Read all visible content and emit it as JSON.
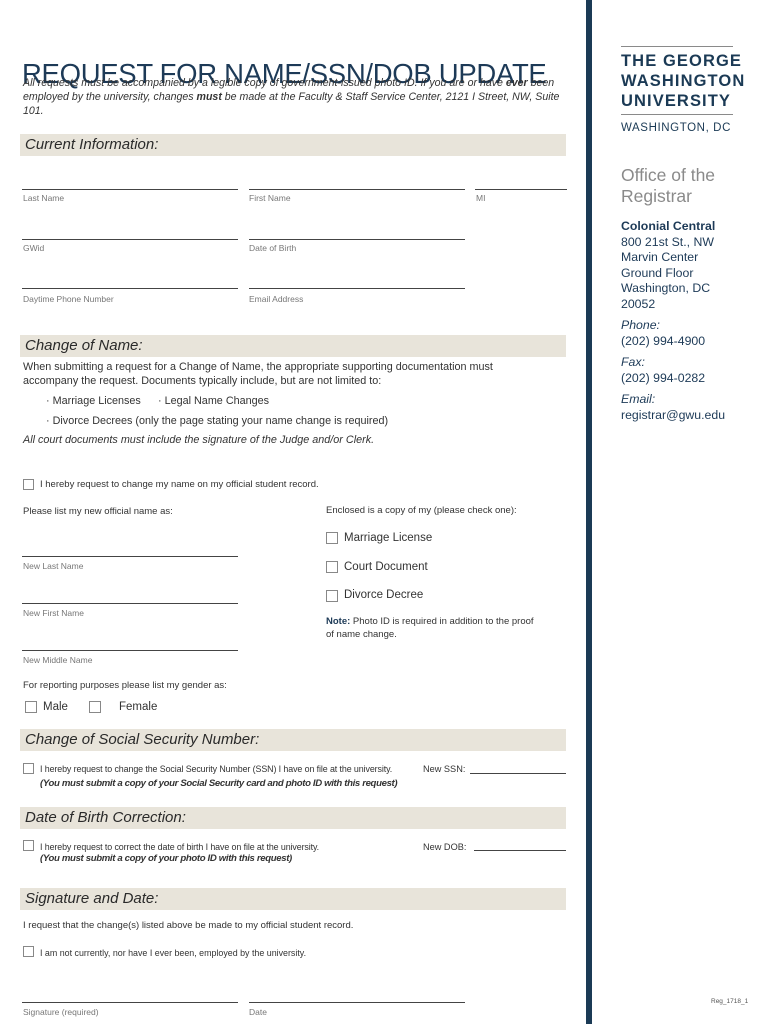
{
  "document": {
    "title": "REQUEST FOR NAME/SSN/DOB UPDATE",
    "intro": {
      "part1": "All requests must be accompanied by a legible copy of government-issued photo ID. If you are or have ",
      "bold1": "ever",
      "part2": " been employed by the university, changes ",
      "bold2": "must",
      "part3": " be made at the Faculty & Staff Service Center, 2121 I Street, NW, Suite 101."
    },
    "form_code": "Reg_1718_1"
  },
  "sections": {
    "current": {
      "heading": "Current Information:",
      "fields": {
        "last_name": "Last Name",
        "first_name": "First Name",
        "mi": "MI",
        "gwid": "GWid",
        "dob": "Date of Birth",
        "phone": "Daytime Phone Number",
        "email": "Email Address"
      }
    },
    "name": {
      "heading": "Change of Name:",
      "desc_line1": "When submitting a request for a Change of Name, the appropriate supporting documentation must",
      "desc_line2": "accompany the request. Documents typically include, but are not limited to:",
      "docs": [
        "· Marriage Licenses",
        "· Legal Name Changes",
        "· Divorce Decrees (only the page stating your name change is required)"
      ],
      "court_note": "All court documents must include the signature of the Judge and/or Clerk.",
      "request_checkbox": "I hereby request to change my name on my official student record.",
      "list_prompt": "Please list my new official name as:",
      "enclosed_prompt": "Enclosed is a copy of my (please check one):",
      "enclosed_options": [
        "Marriage License",
        "Court Document",
        "Divorce Decree"
      ],
      "new_fields": {
        "last": "New Last Name",
        "first": "New First Name",
        "middle": "New Middle Name"
      },
      "note_label": "Note:",
      "note_line1": " Photo ID is required in addition to the proof",
      "note_line2": "of name change.",
      "gender_prompt": "For reporting purposes please list my gender as:",
      "gender_options": [
        "Male",
        "Female"
      ]
    },
    "ssn": {
      "heading": "Change of Social Security Number:",
      "checkbox": "I hereby request to change the Social Security Number (SSN) I have on file at the university.",
      "field_label": "New SSN:",
      "condition": "(You must submit a copy of your Social Security card and photo ID with this request)"
    },
    "dob": {
      "heading": "Date of Birth Correction:",
      "checkbox": "I hereby request to correct the date of birth I have on file at the university.",
      "field_label": "New DOB:",
      "condition": "(You must submit a copy of your photo ID with this request)"
    },
    "signature": {
      "heading": "Signature and Date:",
      "statement": "I request that the change(s) listed above be made to my official student record.",
      "employment_checkbox": "I am not currently, nor have I ever been, employed by the university.",
      "signature_label": "Signature (required)",
      "date_label": "Date"
    }
  },
  "sidebar": {
    "logo_lines": [
      "THE GEORGE",
      "WASHINGTON",
      "UNIVERSITY"
    ],
    "logo_city": "WASHINGTON, DC",
    "office": "Office of the Registrar",
    "address": {
      "name": "Colonial Central",
      "lines": [
        "800 21st St., NW",
        "Marvin Center",
        "Ground Floor",
        "Washington, DC",
        "20052"
      ]
    },
    "contacts": [
      {
        "label": "Phone:",
        "value": "(202) 994-4900"
      },
      {
        "label": "Fax:",
        "value": "(202) 994-0282"
      },
      {
        "label": "Email:",
        "value": "registrar@gwu.edu"
      }
    ]
  },
  "colors": {
    "brand_navy": "#1b3a55",
    "band_beige": "#e8e4da",
    "office_gray": "#8a8a8a"
  }
}
